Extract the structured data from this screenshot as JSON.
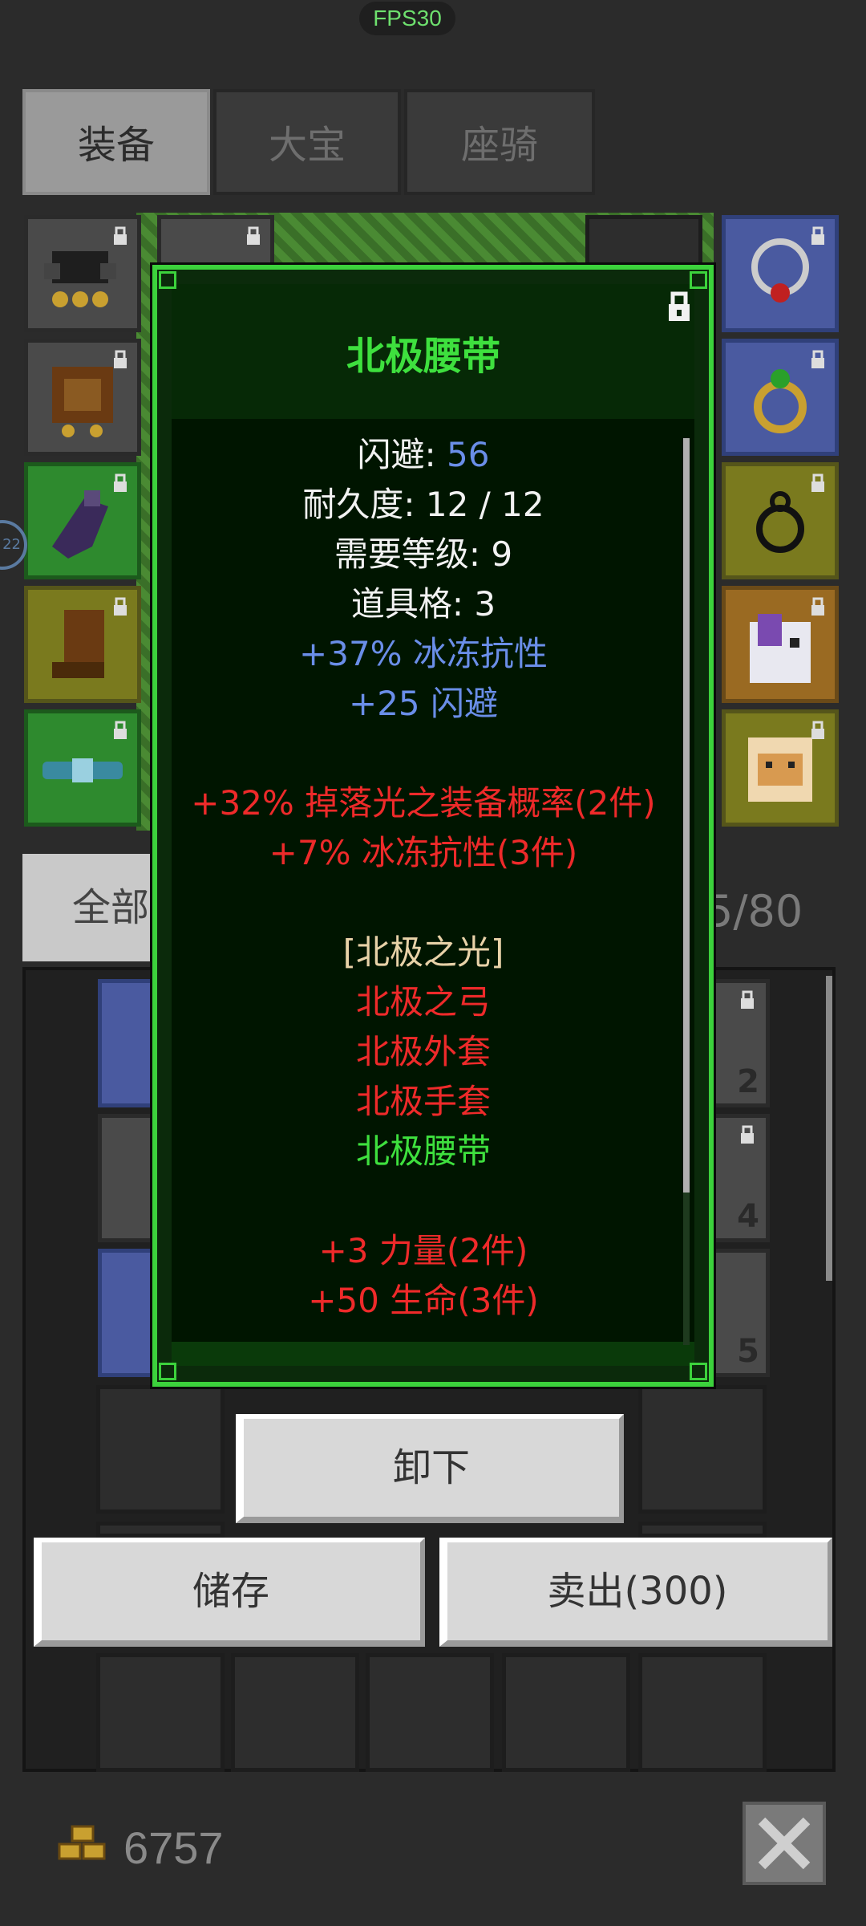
{
  "fps": "FPS30",
  "tabs": [
    {
      "label": "装备",
      "active": true
    },
    {
      "label": "大宝",
      "active": false
    },
    {
      "label": "座骑",
      "active": false
    }
  ],
  "side_indicator": "22",
  "filter_label": "全部",
  "capacity": "5/80",
  "inventory_counts": [
    "2",
    "4",
    "5"
  ],
  "tooltip": {
    "title": "北极腰带",
    "stats": [
      {
        "label": "闪避: ",
        "value": "56"
      },
      {
        "text": "耐久度: 12 / 12"
      },
      {
        "text": "需要等级: 9"
      },
      {
        "text": "道具格: 3"
      }
    ],
    "bonuses": [
      "+37% 冰冻抗性",
      "+25 闪避"
    ],
    "set_bonuses_a": [
      "+32% 掉落光之装备概率(2件)",
      "+7% 冰冻抗性(3件)"
    ],
    "set_name": "[北极之光]",
    "set_items": [
      {
        "name": "北极之弓",
        "owned": false
      },
      {
        "name": "北极外套",
        "owned": false
      },
      {
        "name": "北极手套",
        "owned": false
      },
      {
        "name": "北极腰带",
        "owned": true
      }
    ],
    "set_bonuses_b": [
      "+3 力量(2件)",
      "+50 生命(3件)"
    ]
  },
  "buttons": {
    "unequip": "卸下",
    "store": "储存",
    "sell": "卖出(300)"
  },
  "gold": "6757",
  "colors": {
    "tooltip_border": "#3cd23c",
    "title_green": "#3ee03e",
    "bonus_blue": "#6a8ee8",
    "set_red": "#ee2a2a"
  }
}
